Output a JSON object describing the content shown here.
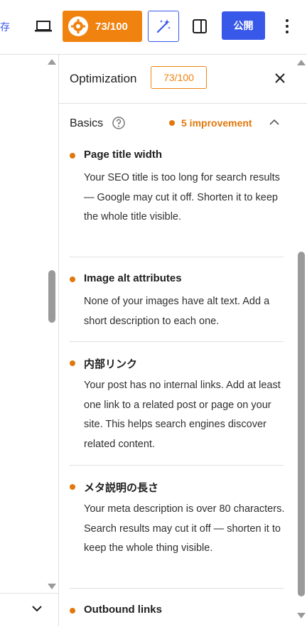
{
  "toolbar": {
    "save_partial": "存",
    "score": "73/100",
    "publish": "公開"
  },
  "panel": {
    "title": "Optimization",
    "score": "73/100",
    "section": {
      "label": "Basics",
      "improvement": "5 improvement"
    },
    "items": [
      {
        "title": "Page title width",
        "description": "Your SEO title is too long for search results — Google may cut it off. Shorten it to keep the whole title visible."
      },
      {
        "title": "Image alt attributes",
        "description": "None of your images have alt text. Add a short description to each one."
      },
      {
        "title": "内部リンク",
        "description": "Your post has no internal links. Add at least one link to a related post or page on your site. This helps search engines discover related content."
      },
      {
        "title": "メタ説明の長さ",
        "description": "Your meta description is over 80 characters. Search results may cut it off — shorten it to keep the whole thing visible."
      },
      {
        "title": "Outbound links",
        "description": ""
      }
    ]
  },
  "colors": {
    "accent": "#3858e9",
    "warning": "#f0820f"
  }
}
